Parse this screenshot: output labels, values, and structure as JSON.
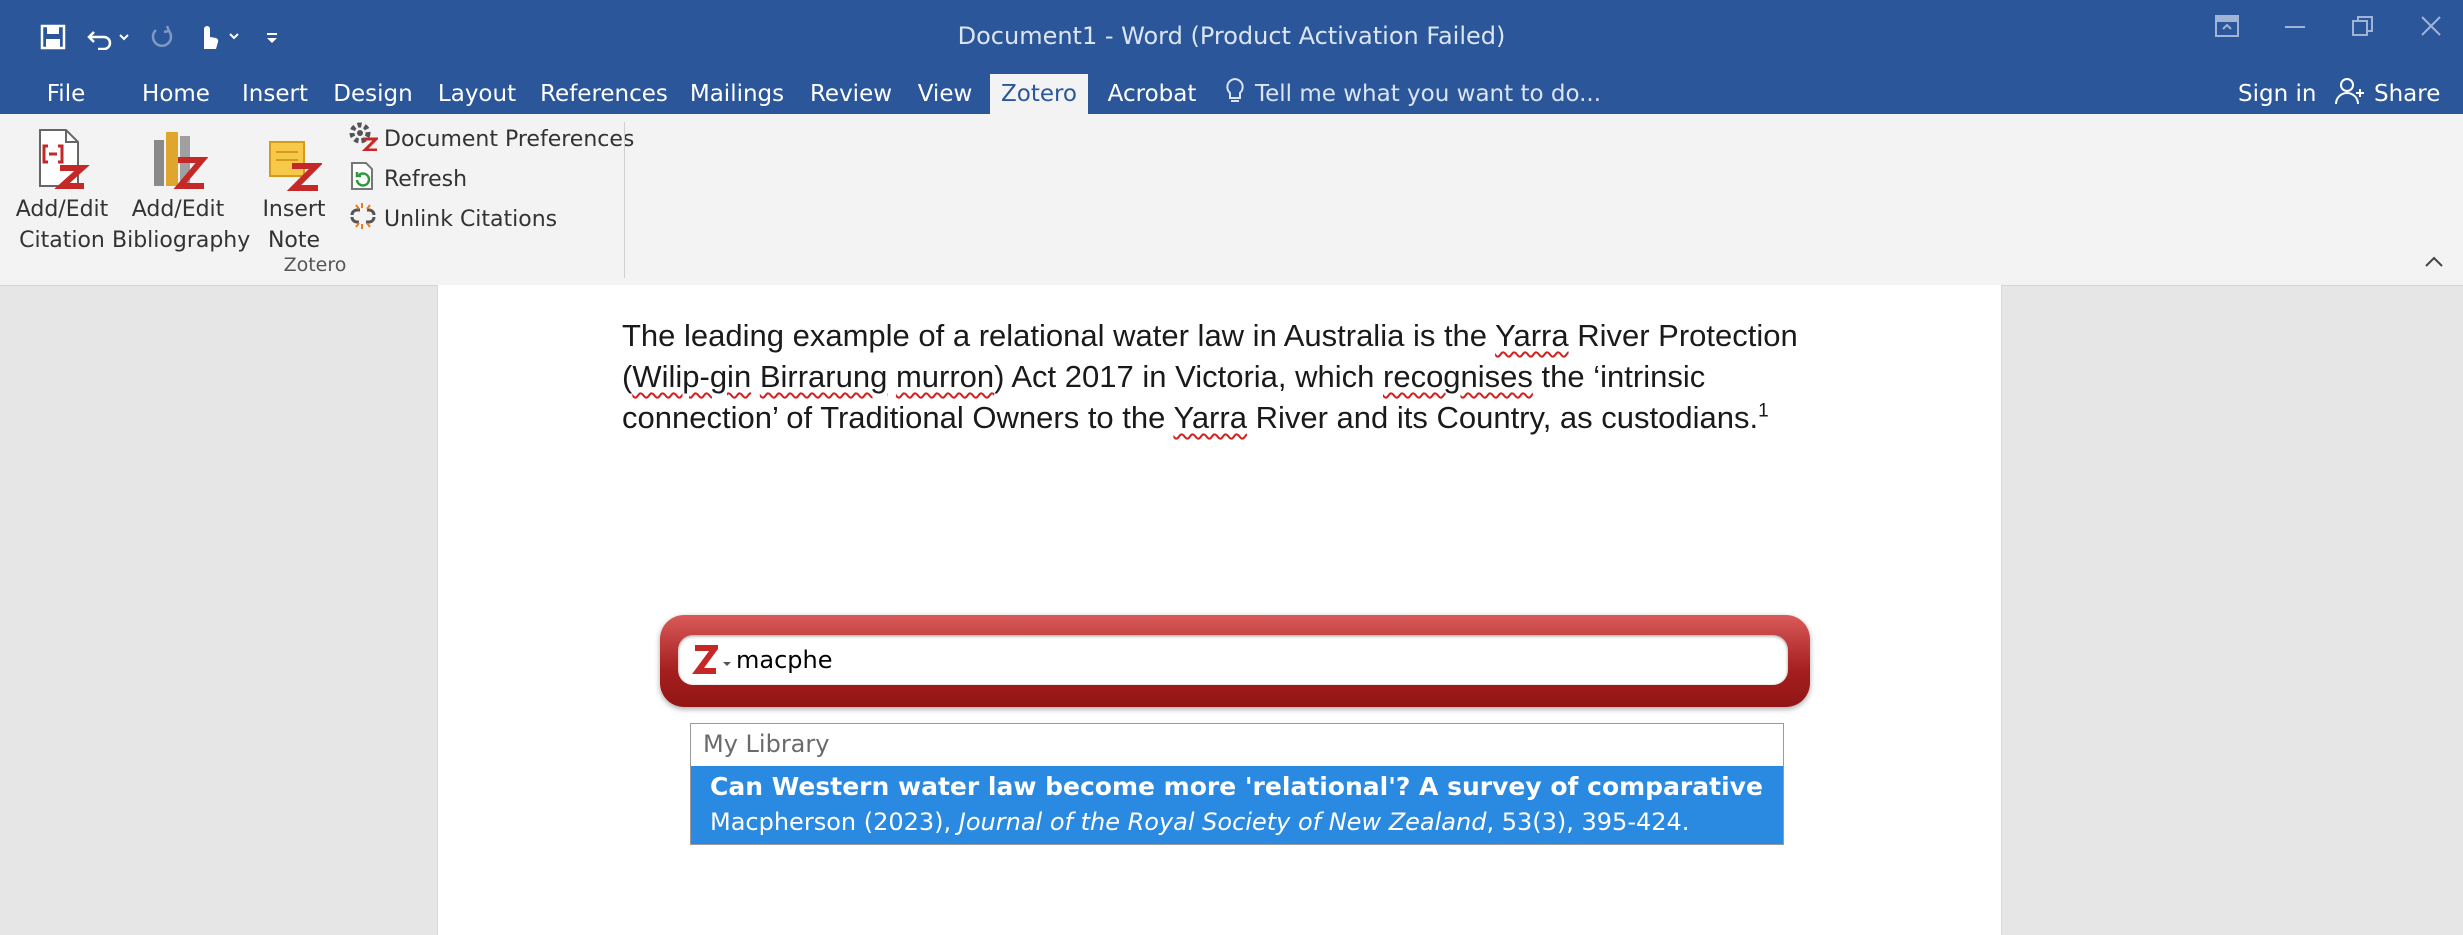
{
  "window": {
    "title": "Document1 - Word (Product Activation Failed)"
  },
  "tabs": [
    {
      "label": "File"
    },
    {
      "label": "Home"
    },
    {
      "label": "Insert"
    },
    {
      "label": "Design"
    },
    {
      "label": "Layout"
    },
    {
      "label": "References"
    },
    {
      "label": "Mailings"
    },
    {
      "label": "Review"
    },
    {
      "label": "View"
    },
    {
      "label": "Zotero",
      "active": true
    },
    {
      "label": "Acrobat"
    }
  ],
  "tell_me": "Tell me what you want to do...",
  "account": {
    "sign_in": "Sign in",
    "share": "Share"
  },
  "ribbon": {
    "add_edit_citation": [
      "Add/Edit",
      "Citation"
    ],
    "add_edit_bibliography": [
      "Add/Edit",
      "Bibliography"
    ],
    "insert_note": [
      "Insert",
      "Note"
    ],
    "document_preferences": "Document Preferences",
    "refresh": "Refresh",
    "unlink_citations": "Unlink Citations",
    "group_label": "Zotero"
  },
  "document": {
    "p1": "The leading example of a relational water law in Australia is the ",
    "w_yarra1": "Yarra",
    "p2": " River Protection (",
    "w_wilip": "Wilip-gin",
    "p3": " ",
    "w_birrarung": "Birrarung",
    "p4": " ",
    "w_murron": "murron",
    "p5": ") Act 2017 in Victoria, which ",
    "w_recognises": "recognises",
    "p6": " the ‘intrinsic connection’ of Traditional Owners to the ",
    "w_yarra2": "Yarra",
    "p7": " River and its Country, as custodians.",
    "footnote": "1"
  },
  "zotero": {
    "search_value": "macphe",
    "library_heading": "My Library",
    "result": {
      "title": "Can Western water law become more 'relational'? A survey of comparative laws ...",
      "author_year": "Macpherson (2023), ",
      "journal": "Journal of the Royal Society of New Zealand",
      "details": ", 53(3), 395-424."
    }
  },
  "colors": {
    "title_bar": "#2b579a",
    "ribbon_bg": "#f3f3f3",
    "zotero_red": "#a51f1f",
    "selection_blue": "#2a8ae2"
  }
}
